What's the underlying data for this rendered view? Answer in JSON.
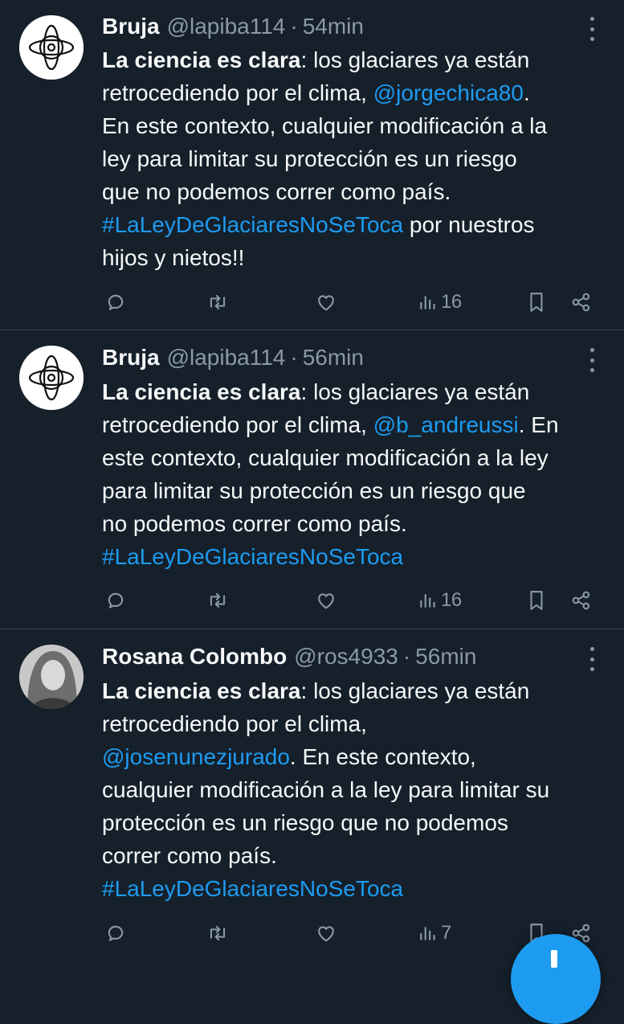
{
  "tweets": [
    {
      "name": "Bruja",
      "handle": "@lapiba114",
      "separator": "·",
      "time": "54min",
      "lines": [
        [
          {
            "t": "La ciencia es clara",
            "s": "b"
          },
          {
            "t": ": los glaciares ya están",
            "s": ""
          }
        ],
        [
          {
            "t": "retrocediendo por el clima, ",
            "s": ""
          },
          {
            "t": "@jorgechica80",
            "s": "link"
          },
          {
            "t": ".",
            "s": ""
          }
        ],
        [
          {
            "t": "En este contexto, cualquier modificación a la",
            "s": ""
          }
        ],
        [
          {
            "t": "ley para limitar su protección es un riesgo",
            "s": ""
          }
        ],
        [
          {
            "t": "que no podemos correr como país.",
            "s": ""
          }
        ],
        [
          {
            "t": "#LaLeyDeGlaciaresNoSeToca",
            "s": "link"
          },
          {
            "t": "  por nuestros",
            "s": ""
          }
        ],
        [
          {
            "t": "hijos y nietos!!",
            "s": ""
          }
        ]
      ],
      "views": "16"
    },
    {
      "name": "Bruja",
      "handle": "@lapiba114",
      "separator": "·",
      "time": "56min",
      "lines": [
        [
          {
            "t": "La ciencia es clara",
            "s": "b"
          },
          {
            "t": ": los glaciares ya están",
            "s": ""
          }
        ],
        [
          {
            "t": "retrocediendo por el clima, ",
            "s": ""
          },
          {
            "t": "@b_andreussi",
            "s": "link"
          },
          {
            "t": ". En",
            "s": ""
          }
        ],
        [
          {
            "t": "este contexto, cualquier modificación a la ley",
            "s": ""
          }
        ],
        [
          {
            "t": "para limitar su protección es un riesgo que",
            "s": ""
          }
        ],
        [
          {
            "t": "no podemos correr como país.",
            "s": ""
          }
        ],
        [
          {
            "t": "#LaLeyDeGlaciaresNoSeToca",
            "s": "link"
          }
        ]
      ],
      "views": "16"
    },
    {
      "name": "Rosana Colombo",
      "handle": "@ros4933",
      "separator": "·",
      "time": "56min",
      "lines": [
        [
          {
            "t": "La ciencia es clara",
            "s": "b"
          },
          {
            "t": ": los glaciares ya están",
            "s": ""
          }
        ],
        [
          {
            "t": "retrocediendo por el clima,",
            "s": ""
          }
        ],
        [
          {
            "t": "@josenunezjurado",
            "s": "link"
          },
          {
            "t": ". En este contexto,",
            "s": ""
          }
        ],
        [
          {
            "t": "cualquier modificación a la ley para limitar su",
            "s": ""
          }
        ],
        [
          {
            "t": "protección es un riesgo que no podemos",
            "s": ""
          }
        ],
        [
          {
            "t": "correr como país.",
            "s": ""
          }
        ],
        [
          {
            "t": "#LaLeyDeGlaciaresNoSeToca",
            "s": "link"
          }
        ]
      ],
      "views": "7"
    }
  ],
  "icons": {
    "reply": "reply-icon",
    "retweet": "retweet-icon",
    "like": "heart-icon",
    "views": "views-chart-icon",
    "bookmark": "bookmark-icon",
    "share": "share-icon",
    "more": "more-options-icon",
    "compose": "compose-plus-icon"
  },
  "colors": {
    "background": "#15202b",
    "text": "#f7f9f9",
    "secondary": "#8b98a5",
    "accent": "#1d9bf0",
    "divider": "#38444d"
  }
}
